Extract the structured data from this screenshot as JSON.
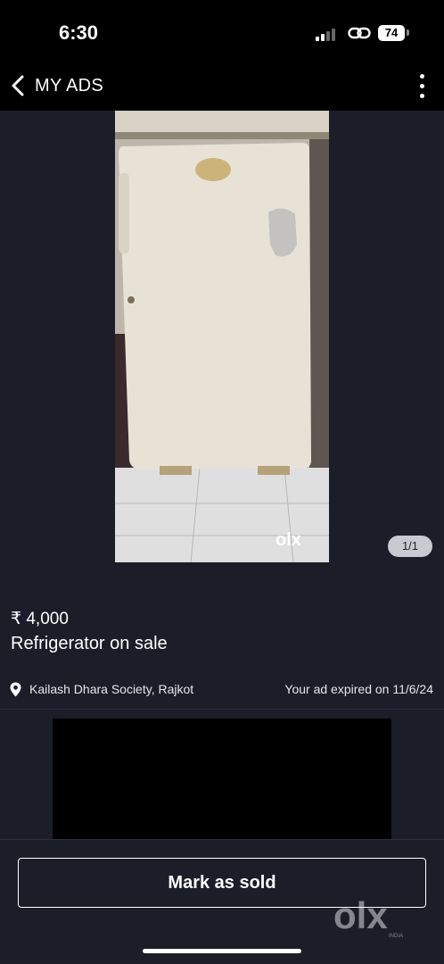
{
  "status_bar": {
    "time": "6:30",
    "battery": "74",
    "icons": [
      "signal-icon",
      "link-icon",
      "battery-icon"
    ]
  },
  "nav": {
    "back_icon": "chevron-left-icon",
    "title": "MY ADS",
    "more_icon": "vertical-ellipsis-icon"
  },
  "gallery": {
    "counter": "1/1",
    "watermark": "olx"
  },
  "ad": {
    "price": "₹ 4,000",
    "title": "Refrigerator on sale",
    "location": "Kailash Dhara Society, Rajkot",
    "location_icon": "location-pin-icon",
    "expiry": "Your ad expired on 11/6/24"
  },
  "actions": {
    "mark_sold": "Mark as sold"
  },
  "branding": {
    "watermark": "olx",
    "sub": "INDIA"
  },
  "colors": {
    "background": "#1b1e29",
    "bar": "#000000",
    "counter_pill": "#c7cbd1"
  }
}
